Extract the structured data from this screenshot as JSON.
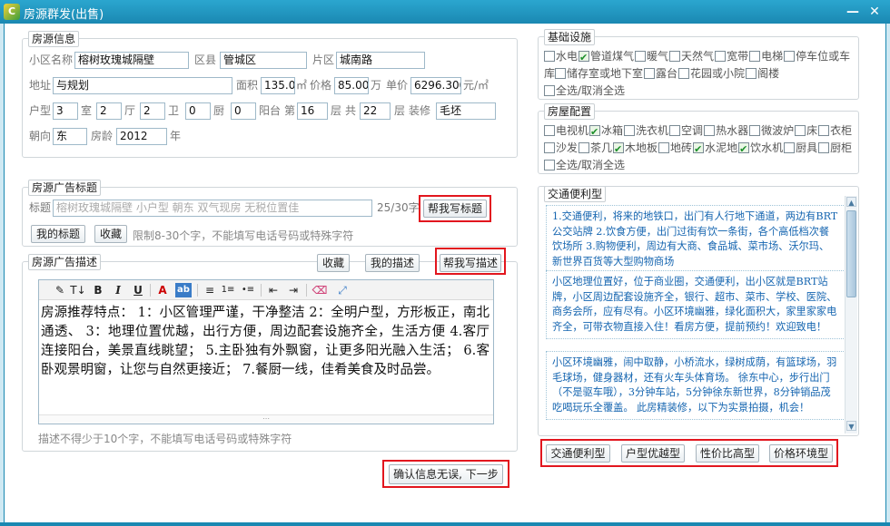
{
  "window": {
    "title": "房源群发(出售)",
    "logo": "C"
  },
  "basic_info": {
    "legend": "房源信息",
    "community_label": "小区名称",
    "community": "榕树玫瑰城隔壁",
    "district_label": "区县",
    "district": "管城区",
    "area_label": "片区",
    "area": "城南路",
    "address_label": "地址",
    "address": "与规划",
    "size_label": "面积",
    "size": "135.0",
    "size_unit": "㎡",
    "price_label": "价格",
    "price": "85.00",
    "price_unit": "万",
    "unit_price_label": "单价",
    "unit_price": "6296.3000",
    "unit_price_unit": "元/㎡",
    "layout_label": "户型",
    "rooms": "3",
    "rooms_unit": "室",
    "halls": "2",
    "halls_unit": "厅",
    "baths": "2",
    "baths_unit": "卫",
    "kitchens": "0",
    "kitchens_unit": "厨",
    "balconies": "0",
    "balconies_unit": "阳台",
    "floor_prefix": "第",
    "floor": "16",
    "floor_unit": "层",
    "total_prefix": "共",
    "total_floors": "22",
    "total_unit": "层",
    "decoration_label": "装修",
    "decoration": "毛坯",
    "orientation_label": "朝向",
    "orientation": "东",
    "age_label": "房龄",
    "age": "2012",
    "age_unit": "年"
  },
  "ad_title": {
    "legend": "房源广告标题",
    "label": "标题",
    "placeholder": "榕树玫瑰城隔壁 小户型 朝东 双气现房 无税位置佳",
    "count": "25/30字",
    "help_button": "帮我写标题",
    "my_title_button": "我的标题",
    "save_button": "收藏",
    "hint": "限制8-30个字，不能填写电话号码或特殊字符"
  },
  "ad_desc": {
    "legend": "房源广告描述",
    "save_button": "收藏",
    "my_desc_button": "我的描述",
    "help_button": "帮我写描述",
    "text": "房源推荐特点： 1：小区管理严谨，干净整洁 2：全明户型，方形板正，南北通透、 3：地理位置优越，出行方便，周边配套设施齐全，生活方便 4.客厅连接阳台，美景直线眺望； 5.主卧独有外飘窗，让更多阳光融入生活； 6.客卧观景明窗，让您与自然更接近； 7.餐厨一线，佳肴美食及时品尝。",
    "hint": "描述不得少于10个字，不能填写电话号码或特殊字符"
  },
  "confirm_button": "确认信息无误, 下一步",
  "facilities": {
    "legend": "基础设施",
    "row1": [
      {
        "label": "水电",
        "checked": false
      },
      {
        "label": "管道煤气",
        "checked": true
      },
      {
        "label": "暖气",
        "checked": false
      },
      {
        "label": "天然气",
        "checked": false
      },
      {
        "label": "宽带",
        "checked": false
      },
      {
        "label": "电梯",
        "checked": false
      },
      {
        "label": "停车位或车",
        "checked": false
      }
    ],
    "row2_prefix": "库",
    "row2": [
      {
        "label": "储存室或地下室",
        "checked": false
      },
      {
        "label": "露台",
        "checked": false
      },
      {
        "label": "花园或小院",
        "checked": false
      },
      {
        "label": "阁楼",
        "checked": false
      }
    ],
    "select_all": "全选/取消全选"
  },
  "furnishing": {
    "legend": "房屋配置",
    "row1": [
      {
        "label": "电视机",
        "checked": false
      },
      {
        "label": "冰箱",
        "checked": true
      },
      {
        "label": "洗衣机",
        "checked": false
      },
      {
        "label": "空调",
        "checked": false
      },
      {
        "label": "热水器",
        "checked": false
      },
      {
        "label": "微波炉",
        "checked": false
      },
      {
        "label": "床",
        "checked": false
      },
      {
        "label": "衣柜",
        "checked": false
      }
    ],
    "row2": [
      {
        "label": "沙发",
        "checked": false
      },
      {
        "label": "茶几",
        "checked": false
      },
      {
        "label": "木地板",
        "checked": true
      },
      {
        "label": "地砖",
        "checked": false
      },
      {
        "label": "水泥地",
        "checked": true
      },
      {
        "label": "饮水机",
        "checked": true
      },
      {
        "label": "厨具",
        "checked": false
      },
      {
        "label": "厨柜",
        "checked": false
      }
    ],
    "select_all": "全选/取消全选"
  },
  "templates": {
    "legend": "交通便利型",
    "cards": [
      "1.交通便利，将来的地铁口，出门有人行地下通道，两边有BRT公交站牌 2.饮食方便，出门过街有饮一条街，各个高低档次餐饮场所 3.购物便利，周边有大商、食品城、菜市场、沃尔玛、新世界百货等大型购物商场",
      "小区地理位置好，位于商业圈，交通便利，出小区就是BRT站牌，小区周边配套设施齐全，银行、超市、菜市、学校、医院、商务会所，应有尽有。小区环境幽雅，绿化面积大，家里家家电齐全，可带衣物直接入住！看房方便，提前预约！欢迎致电！",
      "小区环境幽雅，闹中取静，小桥流水，绿树成荫，有篮球场，羽毛球场，健身器材，还有火车头体育场。 徐东中心，步行出门（不是驱车哦），3分钟车站，5分钟徐东新世界，8分钟销品茂吃喝玩乐全覆盖。 此房精装修，以下为实景拍摄，机会！"
    ],
    "types": [
      "交通便利型",
      "户型优越型",
      "性价比高型",
      "价格环境型"
    ]
  }
}
